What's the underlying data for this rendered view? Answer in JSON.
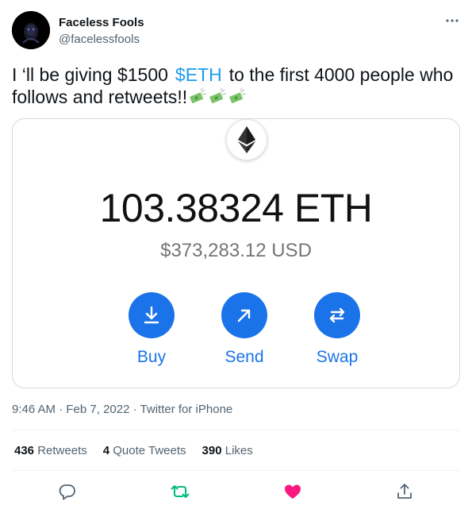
{
  "author": {
    "name": "Faceless Fools",
    "handle": "@facelessfools"
  },
  "tweet": {
    "text_before": "I ‘ll be giving $1500",
    "cashtag": "$ETH",
    "text_after": "to the first 4000 people who follows and retweets!!",
    "emoji": "money-with-wings-icon"
  },
  "media": {
    "balance": "103.38324 ETH",
    "balance_usd": "$373,283.12 USD",
    "actions": [
      {
        "label": "Buy",
        "icon": "download-icon"
      },
      {
        "label": "Send",
        "icon": "arrow-up-right-icon"
      },
      {
        "label": "Swap",
        "icon": "swap-icon"
      }
    ],
    "accent_color": "#1a73e8"
  },
  "meta": {
    "time": "9:46 AM",
    "date": "Feb 7, 2022",
    "source": "Twitter for iPhone"
  },
  "stats": {
    "retweets_count": "436",
    "retweets_label": "Retweets",
    "quotes_count": "4",
    "quotes_label": "Quote Tweets",
    "likes_count": "390",
    "likes_label": "Likes"
  },
  "colors": {
    "link": "#1d9bf0",
    "retweet_active": "#00ba7c",
    "like_active": "#f91880",
    "secondary_text": "#536471"
  }
}
